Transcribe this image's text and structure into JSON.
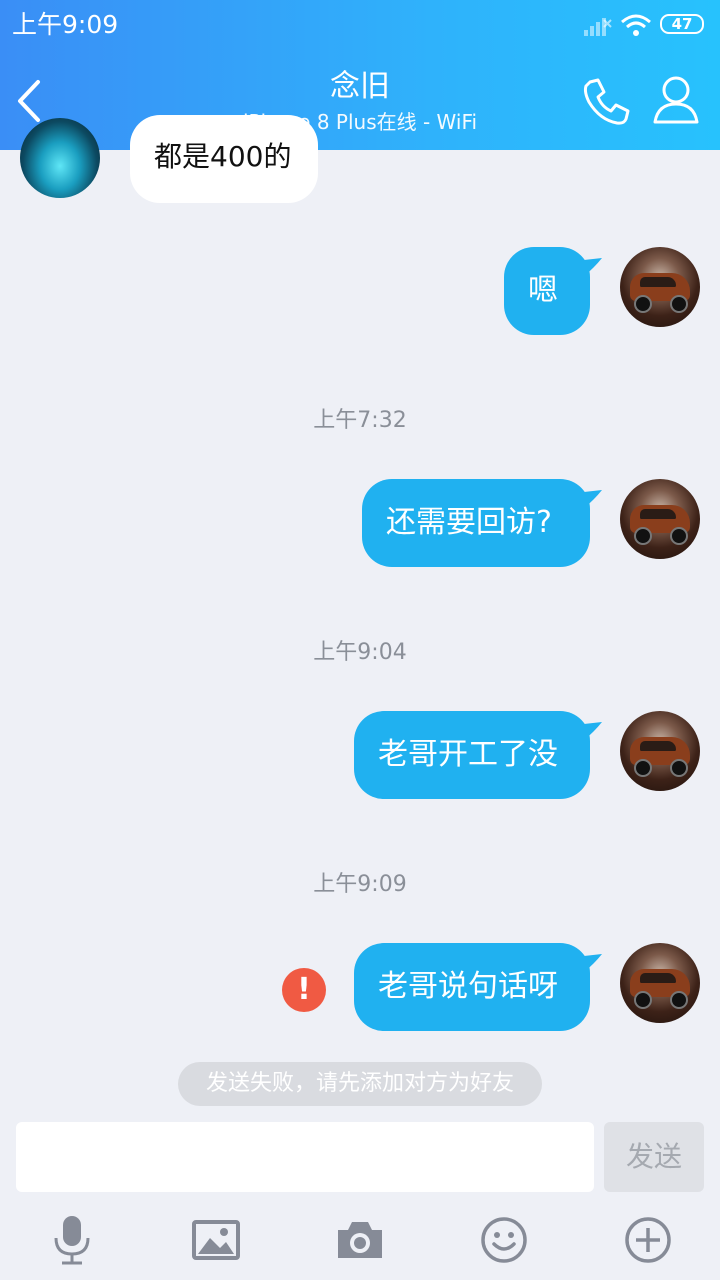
{
  "status_bar": {
    "time": "上午9:09",
    "battery": "47"
  },
  "header": {
    "title": "念旧",
    "subtitle": "iPhone 8 Plus在线 - WiFi"
  },
  "messages": [
    {
      "text": "都是400的"
    },
    {
      "text": "嗯"
    },
    {
      "time": "上午7:32",
      "text": "还需要回访?"
    },
    {
      "time": "上午9:04",
      "text": "老哥开工了没"
    },
    {
      "time": "上午9:09",
      "text": "老哥说句话呀"
    }
  ],
  "fail_icon": "!",
  "notice": "发送失败，请先添加对方为好友",
  "composer": {
    "input_value": "",
    "send_label": "发送"
  },
  "toolbar": [
    "microphone-icon",
    "image-icon",
    "camera-icon",
    "emoji-icon",
    "plus-icon"
  ],
  "colors": {
    "header_start": "#3a8ef6",
    "header_end": "#27c2fd",
    "bubble_out": "#20b1f0",
    "fail": "#f05a43"
  }
}
